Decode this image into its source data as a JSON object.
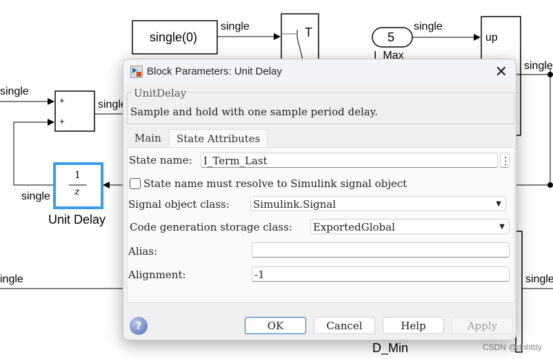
{
  "diagram": {
    "signal_label": "single",
    "signal_label_partial": "ingle",
    "constant_block_label": "single(0)",
    "switch_label": "T",
    "const5_value": "5",
    "const5_name": "I_Max",
    "block_up_port": "up",
    "sum_port_plus": "+",
    "unit_delay_num": "1",
    "unit_delay_den": "z",
    "unit_delay_name": "Unit Delay",
    "dmin_name": "D_Min",
    "watermark": "CSDN @dhhttty",
    "highlight_color": "#3a9de8"
  },
  "dialog": {
    "title": "Block Parameters: Unit Delay",
    "group_title": "UnitDelay",
    "description": "Sample and hold with one sample period delay.",
    "tabs": [
      {
        "label": "Main"
      },
      {
        "label": "State Attributes",
        "active": true
      }
    ],
    "state_name_label": "State name:",
    "state_name_value": "I_Term_Last",
    "resolve_checkbox_label": "State name must resolve to Simulink signal object",
    "resolve_checked": false,
    "signal_object_class_label": "Signal object class:",
    "signal_object_class_value": "Simulink.Signal",
    "storage_class_label": "Code generation storage class:",
    "storage_class_value": "ExportedGlobal",
    "alias_label": "Alias:",
    "alias_value": "",
    "alignment_label": "Alignment:",
    "alignment_value": "-1",
    "buttons": {
      "ok": "OK",
      "cancel": "Cancel",
      "help": "Help",
      "apply": "Apply"
    },
    "help_icon_glyph": "?",
    "close_glyph": "✕",
    "more_glyph": "⋮"
  }
}
